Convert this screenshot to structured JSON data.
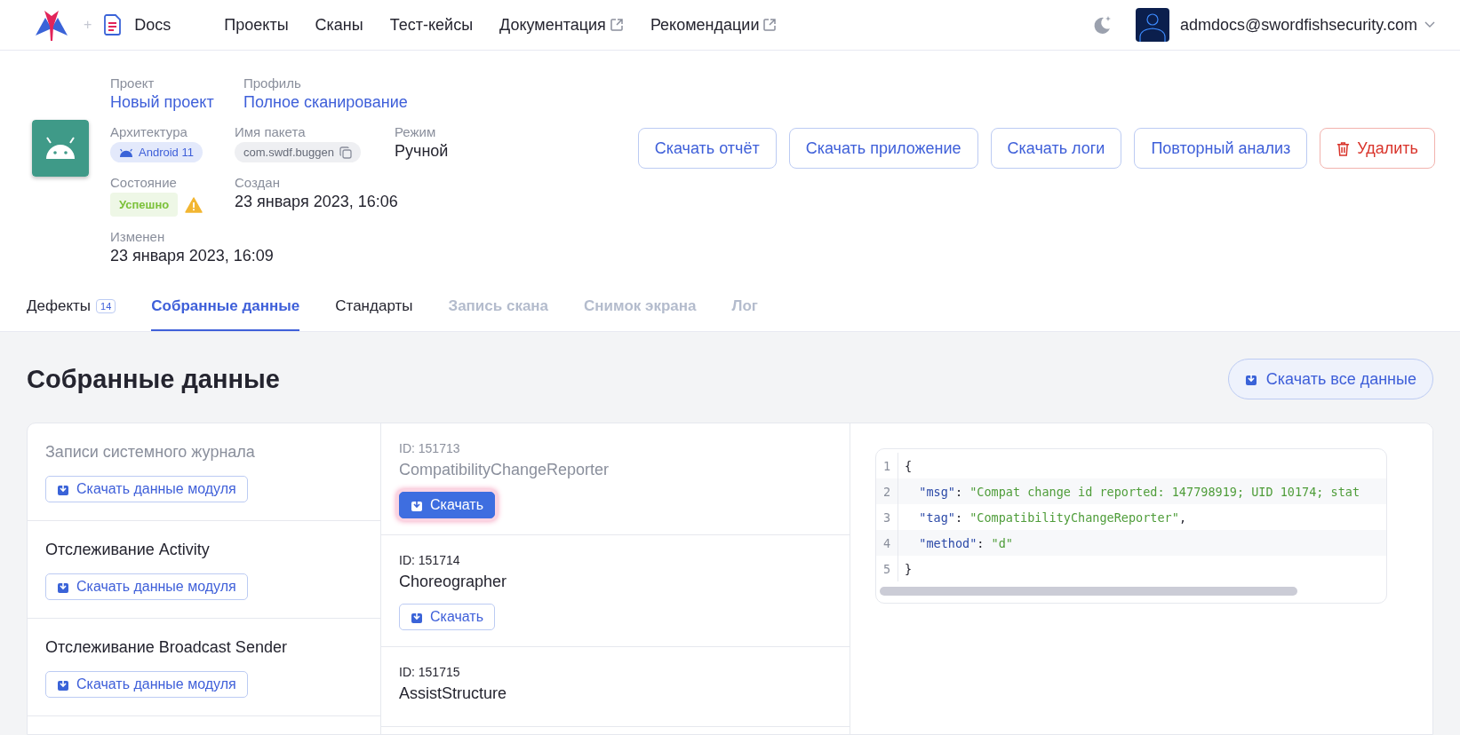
{
  "header": {
    "separator": "+",
    "product": "Docs",
    "nav": [
      {
        "label": "Проекты",
        "external": false
      },
      {
        "label": "Сканы",
        "external": false
      },
      {
        "label": "Тест-кейсы",
        "external": false
      },
      {
        "label": "Документация",
        "external": true
      },
      {
        "label": "Рекомендации",
        "external": true
      }
    ],
    "user": {
      "email": "admdocs@swordfishsecurity.com"
    }
  },
  "scan": {
    "project": {
      "label": "Проект",
      "value": "Новый проект"
    },
    "profile": {
      "label": "Профиль",
      "value": "Полное сканирование"
    },
    "architecture": {
      "label": "Архитектура",
      "value": "Android 11"
    },
    "package": {
      "label": "Имя пакета",
      "value": "com.swdf.buggen"
    },
    "mode": {
      "label": "Режим",
      "value": "Ручной"
    },
    "state": {
      "label": "Состояние",
      "value": "Успешно",
      "warning": true
    },
    "created": {
      "label": "Создан",
      "value": "23 января 2023, 16:06"
    },
    "modified": {
      "label": "Изменен",
      "value": "23 января 2023, 16:09"
    }
  },
  "actions": [
    {
      "label": "Скачать отчёт",
      "kind": "outline"
    },
    {
      "label": "Скачать приложение",
      "kind": "outline"
    },
    {
      "label": "Скачать логи",
      "kind": "outline"
    },
    {
      "label": "Повторный анализ",
      "kind": "outline"
    },
    {
      "label": "Удалить",
      "kind": "danger"
    }
  ],
  "tabs": [
    {
      "label": "Дефекты",
      "badge": "14",
      "selected": false,
      "disabled": false
    },
    {
      "label": "Собранные данные",
      "selected": true,
      "disabled": false
    },
    {
      "label": "Стандарты",
      "selected": false,
      "disabled": false
    },
    {
      "label": "Запись скана",
      "selected": false,
      "disabled": true
    },
    {
      "label": "Снимок экрана",
      "selected": false,
      "disabled": true
    },
    {
      "label": "Лог",
      "selected": false,
      "disabled": true
    }
  ],
  "section": {
    "title": "Собранные данные",
    "download_all": "Скачать все данные"
  },
  "modules": [
    {
      "title": "Записи системного журнала",
      "button": "Скачать данные модуля",
      "selected": true
    },
    {
      "title": "Отслеживание Activity",
      "button": "Скачать данные модуля",
      "selected": false
    },
    {
      "title": "Отслеживание Broadcast Sender",
      "button": "Скачать данные модуля",
      "selected": false
    }
  ],
  "records": [
    {
      "id": "ID: 151713",
      "name": "CompatibilityChangeReporter",
      "button": "Скачать",
      "selected": true
    },
    {
      "id": "ID: 151714",
      "name": "Choreographer",
      "button": "Скачать",
      "selected": false
    },
    {
      "id": "ID: 151715",
      "name": "AssistStructure",
      "selected": false
    }
  ],
  "code": {
    "lines": [
      {
        "number": "1",
        "tokens": [
          {
            "kind": "punct",
            "text": "{"
          }
        ]
      },
      {
        "number": "2",
        "tokens": [
          {
            "kind": "key",
            "text": "  \"msg\""
          },
          {
            "kind": "punct",
            "text": ": "
          },
          {
            "kind": "string",
            "text": "\"Compat change id reported: 147798919; UID 10174; stat"
          }
        ]
      },
      {
        "number": "3",
        "tokens": [
          {
            "kind": "key",
            "text": "  \"tag\""
          },
          {
            "kind": "punct",
            "text": ": "
          },
          {
            "kind": "string",
            "text": "\"CompatibilityChangeReporter\""
          },
          {
            "kind": "punct",
            "text": ","
          }
        ]
      },
      {
        "number": "4",
        "tokens": [
          {
            "kind": "key",
            "text": "  \"method\""
          },
          {
            "kind": "punct",
            "text": ": "
          },
          {
            "kind": "string",
            "text": "\"d\""
          }
        ]
      },
      {
        "number": "5",
        "tokens": [
          {
            "kind": "punct",
            "text": "}"
          }
        ]
      }
    ]
  }
}
